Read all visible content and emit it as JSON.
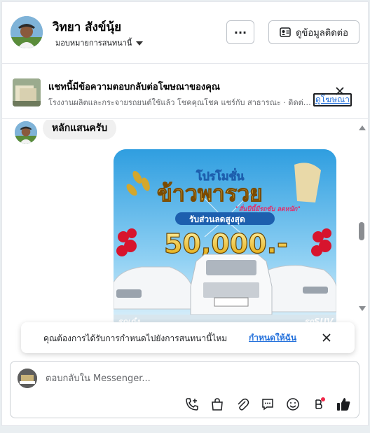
{
  "header": {
    "name": "วิทยา สังข์นุ้ย",
    "subtitle": "มอบหมายการสนทนานี้",
    "more_label": "···",
    "contact_label": "ดูข้อมูลติดต่อ"
  },
  "ad_banner": {
    "title": "แชทนี้มีข้อความตอบกลับต่อโฆษณาของคุณ",
    "description": "โรงงานผลิตและกระจายรถยนต์ใช้แล้ว โชคคุณโชค แชร์กับ สาธารณะ · ดิดต่อเรา",
    "view_label": "ดูโฆษณา"
  },
  "messages": [
    {
      "text": "หลักแสนครับ"
    }
  ],
  "promo": {
    "headline1": "โปรโมชั่น",
    "headline2": "ข้าวพารวย",
    "tagline": "\"สั่นปีนี้มีรถขับ ลดหนัก\"",
    "discount_label": "รับส่วนลดสูงสุด",
    "discount_value": "50,000.-",
    "left_tag": "รถเก๋ง",
    "right_tag": "รถSUV"
  },
  "toast": {
    "text": "คุณต้องการได้รับการกำหนดไปยังการสนทนานี้ไหม",
    "action": "กำหนดให้ฉัน"
  },
  "composer": {
    "placeholder": "ตอบกลับใน Messenger..."
  },
  "colors": {
    "accent": "#216fdb",
    "like": "#1c1e21",
    "notify_dot": "#f02849"
  }
}
